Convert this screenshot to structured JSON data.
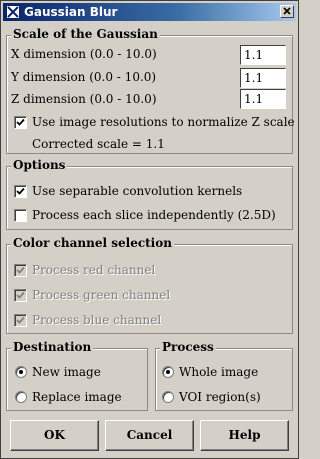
{
  "window": {
    "title": "Gaussian Blur"
  },
  "scale": {
    "legend": "Scale of the Gaussian",
    "x_label": "X dimension (0.0 - 10.0)",
    "x_value": "1.1",
    "y_label": "Y dimension (0.0 - 10.0)",
    "y_value": "1.1",
    "z_label": "Z dimension (0.0 - 10.0)",
    "z_value": "1.1",
    "normalize_label": "Use image resolutions to normalize Z scale",
    "normalize_checked": true,
    "corrected_label": "Corrected scale = 1.1"
  },
  "options": {
    "legend": "Options",
    "separable_label": "Use separable convolution kernels",
    "separable_checked": true,
    "each_slice_label": "Process each slice independently (2.5D)",
    "each_slice_checked": false
  },
  "color": {
    "legend": "Color channel selection",
    "red_label": "Process red channel",
    "green_label": "Process green channel",
    "blue_label": "Process blue channel",
    "enabled": false
  },
  "destination": {
    "legend": "Destination",
    "new_label": "New image",
    "replace_label": "Replace image",
    "selected": "new"
  },
  "process": {
    "legend": "Process",
    "whole_label": "Whole image",
    "voi_label": "VOI region(s)",
    "selected": "whole"
  },
  "buttons": {
    "ok": "OK",
    "cancel": "Cancel",
    "help": "Help"
  }
}
